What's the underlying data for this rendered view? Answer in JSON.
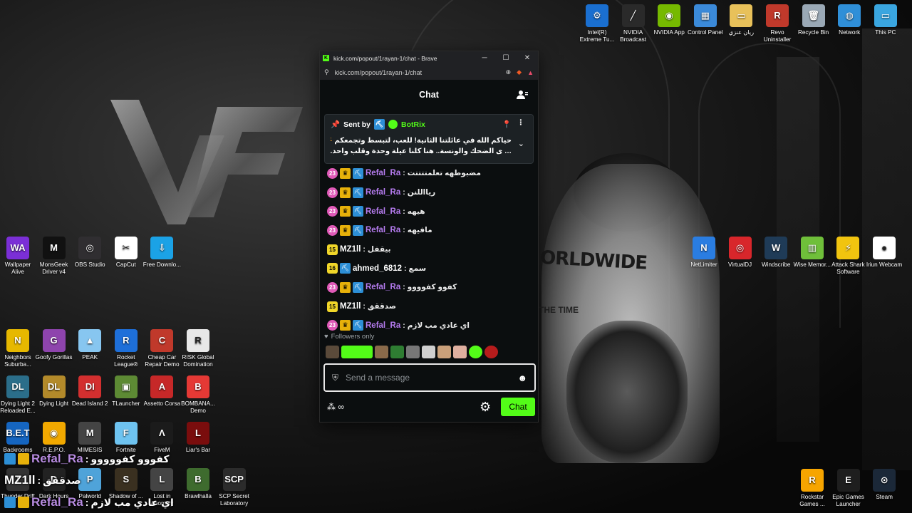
{
  "browser": {
    "title": "kick.com/popout/1rayan-1/chat - Brave",
    "url": "kick.com/popout/1rayan-1/chat"
  },
  "chat": {
    "header": "Chat",
    "pinned": {
      "sent_by_label": "Sent by",
      "sender": "BotRix",
      "message_line1": "حياكم الله في عائلتنا الثانية! للعب، لتبسط وتجمعكم ☀️ Vifty",
      "message_line2": "… ى الضحك والونسة.. هنا كلنا عيلة وحدة وقلب واحد. 💗 🎮"
    },
    "messages": [
      {
        "level": "23",
        "level_style": "pink",
        "crown": true,
        "user": "Refal_Ra",
        "user_color": "#b67cf0",
        "text": "مضبوطهه تعلمتتتتت"
      },
      {
        "level": "23",
        "level_style": "pink",
        "crown": true,
        "user": "Refal_Ra",
        "user_color": "#b67cf0",
        "text": "ريااللنن"
      },
      {
        "level": "23",
        "level_style": "pink",
        "crown": true,
        "user": "Refal_Ra",
        "user_color": "#b67cf0",
        "text": "هيهه"
      },
      {
        "level": "23",
        "level_style": "pink",
        "crown": true,
        "user": "Refal_Ra",
        "user_color": "#b67cf0",
        "text": "مافيهه"
      },
      {
        "level": "15",
        "level_style": "yellow",
        "crown": false,
        "pick": false,
        "user": "MZ1ll",
        "user_color": "#ffffff",
        "text": "بيقفل"
      },
      {
        "level": "16",
        "level_style": "yellow",
        "crown": false,
        "pick": true,
        "user": "ahmed_6812",
        "user_color": "#ffffff",
        "text": "سمع"
      },
      {
        "level": "23",
        "level_style": "pink",
        "crown": true,
        "user": "Refal_Ra",
        "user_color": "#b67cf0",
        "text": "كفوو كفوووو"
      },
      {
        "level": "15",
        "level_style": "yellow",
        "crown": false,
        "pick": false,
        "user": "MZ1ll",
        "user_color": "#ffffff",
        "text": "صدققق"
      },
      {
        "level": "23",
        "level_style": "pink",
        "crown": true,
        "user": "Refal_Ra",
        "user_color": "#b67cf0",
        "text": "اي عادي مب لازم"
      }
    ],
    "followers_only": "Followers only",
    "input_placeholder": "Send a message",
    "send_button": "Chat"
  },
  "overlay": [
    {
      "user": "Refal_Ra",
      "text": "كفووو كفووووو"
    },
    {
      "user": "MZ1ll",
      "text": "صدققق"
    },
    {
      "user": "Refal_Ra",
      "text": "اي عادي مب لازم"
    }
  ],
  "desktop_icons_right_top": [
    {
      "label": "Intel(R) Extreme Tu...",
      "color": "#1a6fd0",
      "glyph": "⚙"
    },
    {
      "label": "NVIDIA Broadcast",
      "color": "#2a2a2a",
      "glyph": "╱"
    },
    {
      "label": "NVIDIA App",
      "color": "#76b900",
      "glyph": "◉"
    },
    {
      "label": "Control Panel",
      "color": "#3b8ad9",
      "glyph": "▦"
    },
    {
      "label": "ريان عنزي",
      "color": "#e8c15a",
      "glyph": "▭"
    },
    {
      "label": "Revo Uninstaller",
      "color": "#c0392b",
      "glyph": "R"
    },
    {
      "label": "Recycle Bin",
      "color": "#9aa8b5",
      "glyph": "🗑"
    },
    {
      "label": "Network",
      "color": "#2f8fd8",
      "glyph": "◍"
    },
    {
      "label": "This PC",
      "color": "#3aa6e0",
      "glyph": "▭"
    }
  ],
  "desktop_icons_right_mid": [
    {
      "label": "NetLimiter",
      "color": "#2a7de1",
      "glyph": "N"
    },
    {
      "label": "VirtualDJ",
      "color": "#d8262b",
      "glyph": "◎"
    },
    {
      "label": "Windscribe",
      "color": "#1f3b57",
      "glyph": "W"
    },
    {
      "label": "Wise Memor...",
      "color": "#6fbf3a",
      "glyph": "▥"
    },
    {
      "label": "Attack Shark Software",
      "color": "#f1c40f",
      "glyph": "⚡"
    },
    {
      "label": "Iriun Webcam",
      "color": "#ffffff",
      "glyph": "●"
    }
  ],
  "desktop_icons_right_bottom": [
    {
      "label": "Rockstar Games ...",
      "color": "#f7a500",
      "glyph": "R"
    },
    {
      "label": "Epic Games Launcher",
      "color": "#1e1e1e",
      "glyph": "E"
    },
    {
      "label": "Steam",
      "color": "#1b2838",
      "glyph": "⊙"
    }
  ],
  "desktop_icons_left_row1": [
    {
      "label": "Wallpaper Alive",
      "color": "#7b2fd6",
      "glyph": "WA"
    },
    {
      "label": "MonsGeek Driver v4",
      "color": "#111111",
      "glyph": "M"
    },
    {
      "label": "OBS Studio",
      "color": "#302e31",
      "glyph": "◎"
    },
    {
      "label": "CapCut",
      "color": "#ffffff",
      "glyph": "✂"
    },
    {
      "label": "Free Downlo...",
      "color": "#1ba2e6",
      "glyph": "⇩"
    }
  ],
  "desktop_icons_left_row2": [
    {
      "label": "Neighbors Suburba...",
      "color": "#e6b800",
      "glyph": "N"
    },
    {
      "label": "Goofy Gorillas",
      "color": "#8e44ad",
      "glyph": "G"
    },
    {
      "label": "PEAK",
      "color": "#87c6f0",
      "glyph": "▲"
    },
    {
      "label": "Rocket League®",
      "color": "#1e6fd9",
      "glyph": "R"
    },
    {
      "label": "Cheap Car Repair Demo",
      "color": "#c0392b",
      "glyph": "C"
    },
    {
      "label": "RISK Global Domination",
      "color": "#e8e8e8",
      "glyph": "R"
    }
  ],
  "desktop_icons_left_row3": [
    {
      "label": "Dying Light 2 Reloaded E...",
      "color": "#2b6e8a",
      "glyph": "DL"
    },
    {
      "label": "Dying Light",
      "color": "#b38a2a",
      "glyph": "DL"
    },
    {
      "label": "Dead Island 2",
      "color": "#d32f2f",
      "glyph": "DI"
    },
    {
      "label": "TLauncher",
      "color": "#5d8a34",
      "glyph": "▣"
    },
    {
      "label": "Assetto Corsa",
      "color": "#c62828",
      "glyph": "A"
    },
    {
      "label": "BOMBANA... Demo",
      "color": "#e53935",
      "glyph": "B"
    }
  ],
  "desktop_icons_left_row4": [
    {
      "label": "Backrooms",
      "color": "#1565c0",
      "glyph": "B.E.T"
    },
    {
      "label": "R.E.P.O.",
      "color": "#f2a900",
      "glyph": "◉"
    },
    {
      "label": "MIMESIS",
      "color": "#444444",
      "glyph": "M"
    },
    {
      "label": "Fortnite",
      "color": "#6ec3f0",
      "glyph": "F"
    },
    {
      "label": "FiveM",
      "color": "#1b1b1b",
      "glyph": "Λ"
    },
    {
      "label": "Liar's Bar",
      "color": "#7a0d0d",
      "glyph": "L"
    }
  ],
  "desktop_icons_left_row5": [
    {
      "label": "Thunder Drift",
      "color": "#333333",
      "glyph": "T"
    },
    {
      "label": "Dark Hours",
      "color": "#222222",
      "glyph": "D"
    },
    {
      "label": "Palworld",
      "color": "#4fa3d9",
      "glyph": "P"
    },
    {
      "label": "Shadow of ...",
      "color": "#3a3020",
      "glyph": "S"
    },
    {
      "label": "Lost in Anomaly",
      "color": "#444444",
      "glyph": "L"
    },
    {
      "label": "Brawlhalla",
      "color": "#3e6b2e",
      "glyph": "B"
    },
    {
      "label": "SCP Secret Laboratory",
      "color": "#2b2b2b",
      "glyph": "SCP"
    }
  ]
}
